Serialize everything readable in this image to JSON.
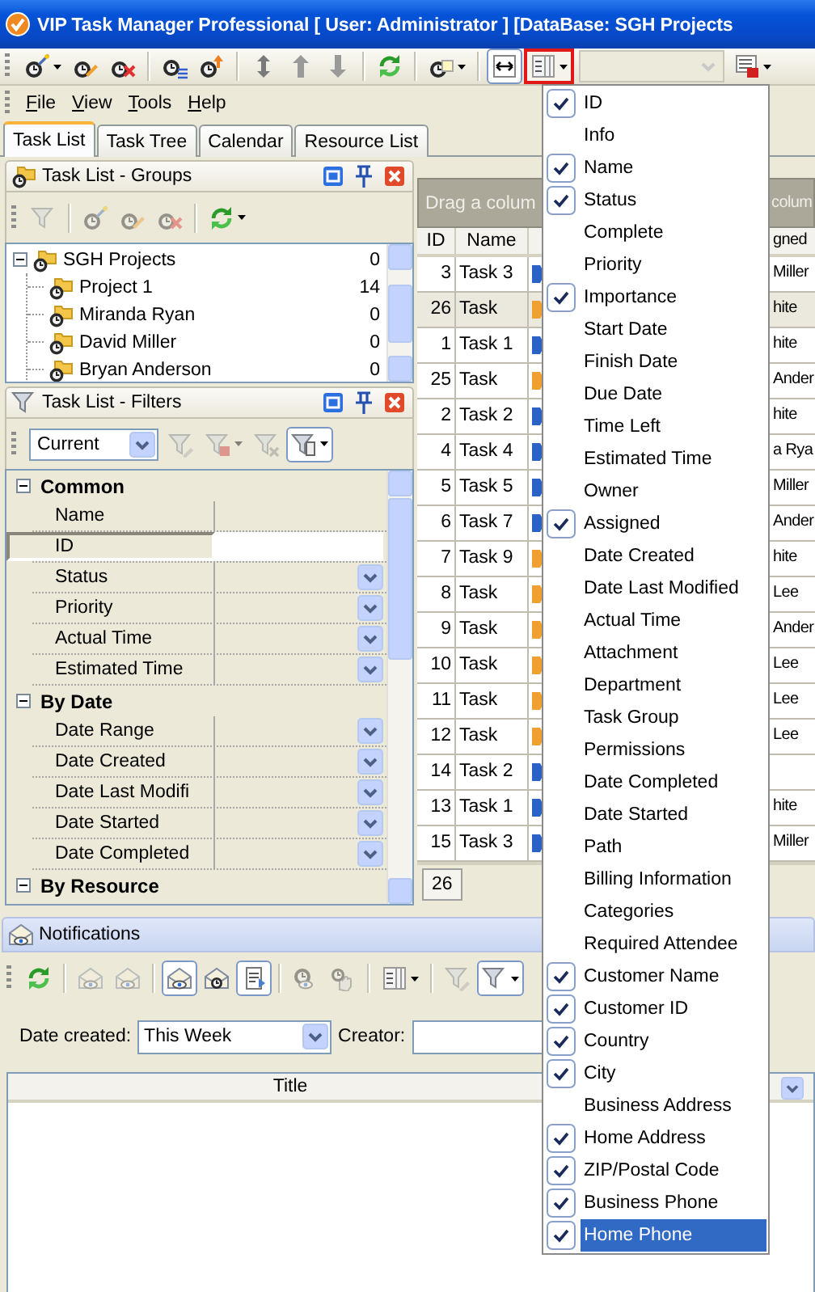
{
  "window": {
    "title": "VIP Task Manager Professional [ User: Administrator ] [DataBase: SGH Projects"
  },
  "toolbar": [
    {
      "kind": "clock-wand",
      "menu": true,
      "pressed": false,
      "disabled": false
    },
    {
      "kind": "clock-pencil",
      "pressed": false,
      "disabled": false
    },
    {
      "kind": "clock-x",
      "pressed": false,
      "disabled": false
    },
    {
      "kind": "separator"
    },
    {
      "kind": "clock-lines",
      "pressed": false,
      "disabled": false
    },
    {
      "kind": "clock-up",
      "pressed": false,
      "disabled": false
    },
    {
      "kind": "separator"
    },
    {
      "kind": "updown",
      "pressed": false,
      "disabled": false
    },
    {
      "kind": "up",
      "pressed": false,
      "disabled": false
    },
    {
      "kind": "down",
      "pressed": false,
      "disabled": false
    },
    {
      "kind": "separator"
    },
    {
      "kind": "refresh",
      "pressed": false,
      "disabled": false
    },
    {
      "kind": "separator"
    },
    {
      "kind": "clock-note",
      "menu": true,
      "pressed": false,
      "disabled": false
    },
    {
      "kind": "separator"
    },
    {
      "kind": "fit-width",
      "pressed": true,
      "disabled": false
    },
    {
      "kind": "columns",
      "menu": true,
      "pressed": false,
      "disabled": false,
      "outlined": true
    },
    {
      "kind": "combo",
      "disabled": true
    },
    {
      "kind": "save",
      "menu": true,
      "pressed": false,
      "disabled": false
    }
  ],
  "menu_bar": [
    "File",
    "View",
    "Tools",
    "Help"
  ],
  "tabs": [
    {
      "label": "Task List",
      "selected": true
    },
    {
      "label": "Task Tree",
      "selected": false
    },
    {
      "label": "Calendar",
      "selected": false
    },
    {
      "label": "Resource List",
      "selected": false
    }
  ],
  "groups_panel": {
    "title": "Task List - Groups",
    "toolbar": [
      {
        "kind": "funnel",
        "pressed": false,
        "disabled": true
      },
      {
        "kind": "separator"
      },
      {
        "kind": "clock-wand",
        "pressed": false,
        "disabled": true
      },
      {
        "kind": "clock-pencil",
        "pressed": false,
        "disabled": true
      },
      {
        "kind": "clock-x",
        "pressed": false,
        "disabled": true
      },
      {
        "kind": "separator"
      },
      {
        "kind": "refresh",
        "menu": true,
        "pressed": false,
        "disabled": false
      }
    ],
    "tree": [
      {
        "name": "SGH Projects",
        "count": "0",
        "expanded": true,
        "children": [
          {
            "name": "Project 1",
            "count": "14"
          },
          {
            "name": "Miranda Ryan",
            "count": "0"
          },
          {
            "name": "David Miller",
            "count": "0"
          },
          {
            "name": "Bryan Anderson",
            "count": "0"
          }
        ]
      }
    ]
  },
  "filters_panel": {
    "title": "Task List - Filters",
    "toolbar": [
      {
        "kind": "combo",
        "value": "Current",
        "disabled": false
      },
      {
        "kind": "funnel-pencil",
        "pressed": false,
        "disabled": true
      },
      {
        "kind": "funnel-save",
        "menu": true,
        "pressed": false,
        "disabled": true
      },
      {
        "kind": "funnel-x",
        "pressed": false,
        "disabled": true
      },
      {
        "kind": "funnel-columns",
        "menu": true,
        "pressed": true,
        "disabled": false
      }
    ],
    "categories": [
      {
        "title": "Common",
        "expanded": true,
        "rows": [
          {
            "label": "Name",
            "kind": "plain",
            "selected": false
          },
          {
            "label": "ID",
            "kind": "text",
            "selected": true
          },
          {
            "label": "Status",
            "kind": "dropdown",
            "selected": false
          },
          {
            "label": "Priority",
            "kind": "dropdown",
            "selected": false
          },
          {
            "label": "Actual Time",
            "kind": "dropdown",
            "selected": false
          },
          {
            "label": "Estimated Time",
            "kind": "dropdown",
            "selected": false
          }
        ]
      },
      {
        "title": "By Date",
        "expanded": true,
        "rows": [
          {
            "label": "Date Range",
            "kind": "dropdown",
            "selected": false
          },
          {
            "label": "Date Created",
            "kind": "dropdown",
            "selected": false
          },
          {
            "label": "Date Last Modifi",
            "kind": "dropdown",
            "selected": false
          },
          {
            "label": "Date Started",
            "kind": "dropdown",
            "selected": false
          },
          {
            "label": "Date Completed",
            "kind": "dropdown",
            "selected": false
          }
        ]
      },
      {
        "title": "By Resource",
        "expanded": true
      }
    ]
  },
  "task_grid": {
    "group_hint": "Drag a colum",
    "group_hint_tail": "colum",
    "columns": {
      "id": "ID",
      "name": "Name",
      "column_4": "gned"
    },
    "rows": [
      {
        "id": "3",
        "name": "Task 3",
        "color": "#2a62c8",
        "column_4": "Miller",
        "selected": false
      },
      {
        "id": "26",
        "name": "Task",
        "color": "#f0a030",
        "column_4": "hite",
        "selected": true
      },
      {
        "id": "1",
        "name": "Task 1",
        "color": "#2a62c8",
        "column_4": "hite",
        "selected": false
      },
      {
        "id": "25",
        "name": "Task",
        "color": "#f0a030",
        "column_4": "Ander",
        "selected": false
      },
      {
        "id": "2",
        "name": "Task 2",
        "color": "#2a62c8",
        "column_4": "hite",
        "selected": false
      },
      {
        "id": "4",
        "name": "Task 4",
        "color": "#2a62c8",
        "column_4": "a Rya",
        "selected": false
      },
      {
        "id": "5",
        "name": "Task 5",
        "color": "#2a62c8",
        "column_4": "Miller",
        "selected": false
      },
      {
        "id": "6",
        "name": "Task 7",
        "color": "#2a62c8",
        "column_4": "Ander",
        "selected": false
      },
      {
        "id": "7",
        "name": "Task 9",
        "color": "#f0a030",
        "column_4": "hite",
        "selected": false
      },
      {
        "id": "8",
        "name": "Task",
        "color": "#f0a030",
        "column_4": "Lee",
        "selected": false
      },
      {
        "id": "9",
        "name": "Task",
        "color": "#f0a030",
        "column_4": "Ander",
        "selected": false
      },
      {
        "id": "10",
        "name": "Task",
        "color": "#f0a030",
        "column_4": "Lee",
        "selected": false
      },
      {
        "id": "11",
        "name": "Task",
        "color": "#f0a030",
        "column_4": "Lee",
        "selected": false
      },
      {
        "id": "12",
        "name": "Task",
        "color": "#f0a030",
        "column_4": "Lee",
        "selected": false
      },
      {
        "id": "14",
        "name": "Task 2",
        "color": "#2a62c8",
        "selected": false
      },
      {
        "id": "13",
        "name": "Task 1",
        "color": "#2a62c8",
        "column_4": "hite",
        "selected": false
      },
      {
        "id": "15",
        "name": "Task 3",
        "color": "#2a62c8",
        "column_4": "Miller",
        "selected": false
      }
    ],
    "footer_count": "26"
  },
  "notifications": {
    "title": "Notifications",
    "toolbar": [
      {
        "kind": "refresh",
        "pressed": false,
        "disabled": false
      },
      {
        "kind": "separator"
      },
      {
        "kind": "envelope-eye",
        "pressed": false,
        "disabled": true
      },
      {
        "kind": "envelope-eye",
        "pressed": false,
        "disabled": true
      },
      {
        "kind": "separator"
      },
      {
        "kind": "envelope-eye",
        "pressed": true,
        "disabled": false
      },
      {
        "kind": "envelope-clock",
        "pressed": false,
        "disabled": false
      },
      {
        "kind": "envelope-doc",
        "pressed": true,
        "disabled": false
      },
      {
        "kind": "separator"
      },
      {
        "kind": "clock-eye",
        "pressed": false,
        "disabled": true
      },
      {
        "kind": "hand",
        "pressed": false,
        "disabled": true
      },
      {
        "kind": "separator"
      },
      {
        "kind": "columns",
        "menu": true,
        "pressed": false,
        "disabled": false
      },
      {
        "kind": "separator"
      },
      {
        "kind": "funnel-pencil",
        "pressed": false,
        "disabled": true
      },
      {
        "kind": "funnel",
        "menu": true,
        "pressed": true,
        "disabled": false
      }
    ],
    "date_created_label": "Date created:",
    "date_created": "This Week",
    "creator_label": "Creator:",
    "columns": [
      "Title"
    ]
  },
  "column_menu": [
    {
      "label": "ID",
      "checked": true,
      "selected": false
    },
    {
      "label": "Info",
      "checked": false,
      "selected": false
    },
    {
      "label": "Name",
      "checked": true,
      "selected": false
    },
    {
      "label": "Status",
      "checked": true,
      "selected": false
    },
    {
      "label": "Complete",
      "checked": false,
      "selected": false
    },
    {
      "label": "Priority",
      "checked": false,
      "selected": false
    },
    {
      "label": "Importance",
      "checked": true,
      "selected": false
    },
    {
      "label": "Start Date",
      "checked": false,
      "selected": false
    },
    {
      "label": "Finish Date",
      "checked": false,
      "selected": false
    },
    {
      "label": "Due Date",
      "checked": false,
      "selected": false
    },
    {
      "label": "Time Left",
      "checked": false,
      "selected": false
    },
    {
      "label": "Estimated Time",
      "checked": false,
      "selected": false
    },
    {
      "label": "Owner",
      "checked": false,
      "selected": false
    },
    {
      "label": "Assigned",
      "checked": true,
      "selected": false
    },
    {
      "label": "Date Created",
      "checked": false,
      "selected": false
    },
    {
      "label": "Date Last Modified",
      "checked": false,
      "selected": false
    },
    {
      "label": "Actual Time",
      "checked": false,
      "selected": false
    },
    {
      "label": "Attachment",
      "checked": false,
      "selected": false
    },
    {
      "label": "Department",
      "checked": false,
      "selected": false
    },
    {
      "label": "Task Group",
      "checked": false,
      "selected": false
    },
    {
      "label": "Permissions",
      "checked": false,
      "selected": false
    },
    {
      "label": "Date Completed",
      "checked": false,
      "selected": false
    },
    {
      "label": "Date Started",
      "checked": false,
      "selected": false
    },
    {
      "label": "Path",
      "checked": false,
      "selected": false
    },
    {
      "label": "Billing Information",
      "checked": false,
      "selected": false
    },
    {
      "label": "Categories",
      "checked": false,
      "selected": false
    },
    {
      "label": "Required Attendee",
      "checked": false,
      "selected": false
    },
    {
      "label": "Customer Name",
      "checked": true,
      "selected": false
    },
    {
      "label": "Customer ID",
      "checked": true,
      "selected": false
    },
    {
      "label": "Country",
      "checked": true,
      "selected": false
    },
    {
      "label": "City",
      "checked": true,
      "selected": false
    },
    {
      "label": "Business Address",
      "checked": false,
      "selected": false
    },
    {
      "label": "Home Address",
      "checked": true,
      "selected": false
    },
    {
      "label": "ZIP/Postal Code",
      "checked": true,
      "selected": false
    },
    {
      "label": "Business Phone",
      "checked": true,
      "selected": false
    },
    {
      "label": "Home Phone",
      "checked": true,
      "selected": true
    }
  ]
}
